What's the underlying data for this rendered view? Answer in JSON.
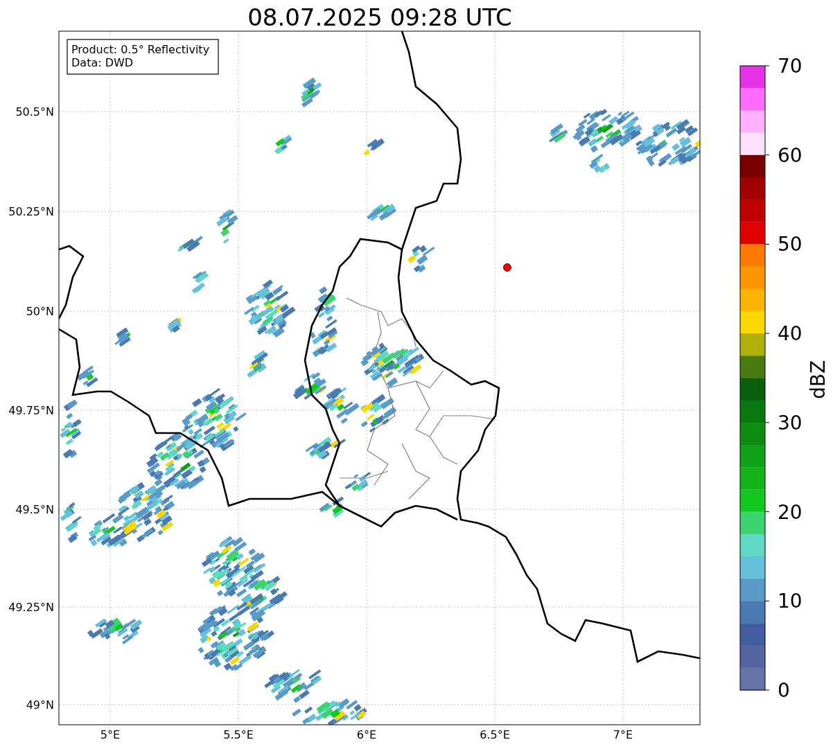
{
  "title": "08.07.2025 09:28 UTC",
  "legend": [
    "Product: 0.5° Reflectivity",
    "Data: DWD"
  ],
  "x_ticks": [
    "5°E",
    "5.5°E",
    "6°E",
    "6.5°E",
    "7°E"
  ],
  "y_ticks": [
    "50.5°N",
    "50.25°N",
    "50°N",
    "49.75°N",
    "49.5°N",
    "49.25°N",
    "49°N"
  ],
  "colorbar": {
    "label": "dBZ",
    "ticks": [
      "70",
      "60",
      "50",
      "40",
      "30",
      "20",
      "10",
      "0"
    ],
    "bins": [
      {
        "color": "#e632e6"
      },
      {
        "color": "#ff6cff"
      },
      {
        "color": "#ffb0ff"
      },
      {
        "color": "#ffe0ff"
      },
      {
        "color": "#780000"
      },
      {
        "color": "#a00000"
      },
      {
        "color": "#c00000"
      },
      {
        "color": "#e00000"
      },
      {
        "color": "#fc7a00"
      },
      {
        "color": "#fc9600"
      },
      {
        "color": "#fcb400"
      },
      {
        "color": "#fcd800"
      },
      {
        "color": "#b0b00a"
      },
      {
        "color": "#487a0e"
      },
      {
        "color": "#0a5e0c"
      },
      {
        "color": "#0a7810"
      },
      {
        "color": "#0e8c12"
      },
      {
        "color": "#10a016"
      },
      {
        "color": "#12b41a"
      },
      {
        "color": "#14c81e"
      },
      {
        "color": "#3cd46e"
      },
      {
        "color": "#60d8c6"
      },
      {
        "color": "#66c0dc"
      },
      {
        "color": "#5a9ac6"
      },
      {
        "color": "#4a7ab0"
      },
      {
        "color": "#425ea0"
      },
      {
        "color": "#5364a0"
      },
      {
        "color": "#6474a8"
      }
    ]
  }
}
